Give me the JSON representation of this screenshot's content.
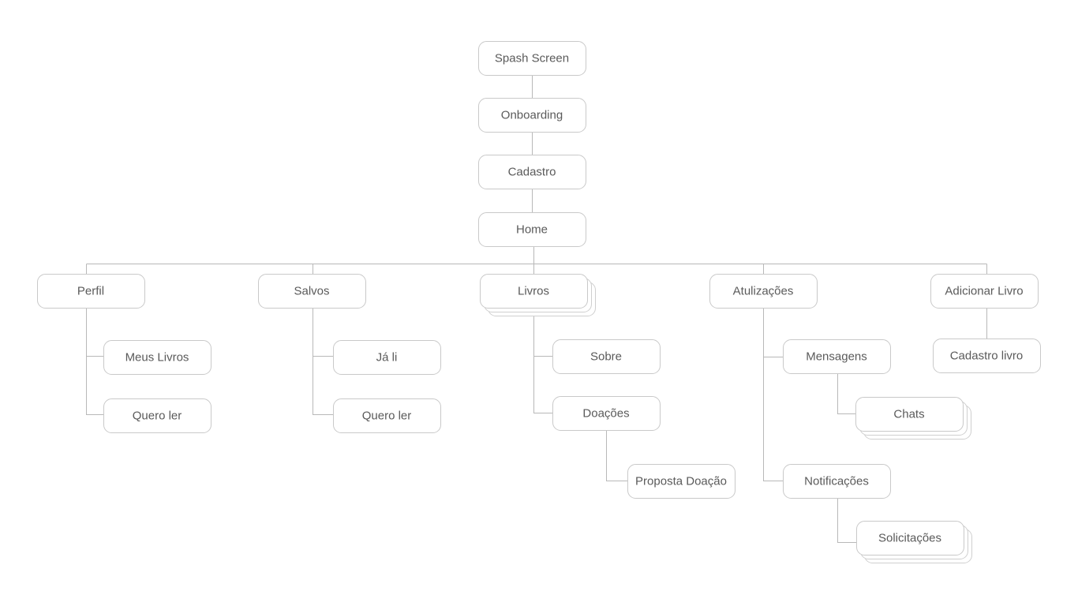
{
  "diagram": {
    "type": "sitemap",
    "nodes": [
      {
        "id": "splash",
        "label": "Spash Screen",
        "parent": null,
        "stacked": false
      },
      {
        "id": "onboarding",
        "label": "Onboarding",
        "parent": "splash",
        "stacked": false
      },
      {
        "id": "cadastro",
        "label": "Cadastro",
        "parent": "onboarding",
        "stacked": false
      },
      {
        "id": "home",
        "label": "Home",
        "parent": "cadastro",
        "stacked": false
      },
      {
        "id": "perfil",
        "label": "Perfil",
        "parent": "home",
        "stacked": false
      },
      {
        "id": "meus-livros",
        "label": "Meus Livros",
        "parent": "perfil",
        "stacked": false
      },
      {
        "id": "perfil-quero-ler",
        "label": "Quero ler",
        "parent": "perfil",
        "stacked": false
      },
      {
        "id": "salvos",
        "label": "Salvos",
        "parent": "home",
        "stacked": false
      },
      {
        "id": "ja-li",
        "label": "Já li",
        "parent": "salvos",
        "stacked": false
      },
      {
        "id": "salvos-quero-ler",
        "label": "Quero ler",
        "parent": "salvos",
        "stacked": false
      },
      {
        "id": "livros",
        "label": "Livros",
        "parent": "home",
        "stacked": true
      },
      {
        "id": "sobre",
        "label": "Sobre",
        "parent": "livros",
        "stacked": false
      },
      {
        "id": "doacoes",
        "label": "Doações",
        "parent": "livros",
        "stacked": false
      },
      {
        "id": "proposta-doacao",
        "label": "Proposta Doação",
        "parent": "doacoes",
        "stacked": false
      },
      {
        "id": "atualizacoes",
        "label": "Atulizações",
        "parent": "home",
        "stacked": false
      },
      {
        "id": "mensagens",
        "label": "Mensagens",
        "parent": "atualizacoes",
        "stacked": false
      },
      {
        "id": "chats",
        "label": "Chats",
        "parent": "mensagens",
        "stacked": true
      },
      {
        "id": "notificacoes",
        "label": "Notificações",
        "parent": "atualizacoes",
        "stacked": false
      },
      {
        "id": "solicitacoes",
        "label": "Solicitações",
        "parent": "notificacoes",
        "stacked": true
      },
      {
        "id": "adicionar-livro",
        "label": "Adicionar Livro",
        "parent": "home",
        "stacked": false
      },
      {
        "id": "cadastro-livro",
        "label": "Cadastro livro",
        "parent": "adicionar-livro",
        "stacked": false
      }
    ],
    "colors": {
      "background": "#ffffff",
      "node_border": "#c9c9c9",
      "edge": "#b8b8b8",
      "text": "#5a5a5a"
    }
  }
}
